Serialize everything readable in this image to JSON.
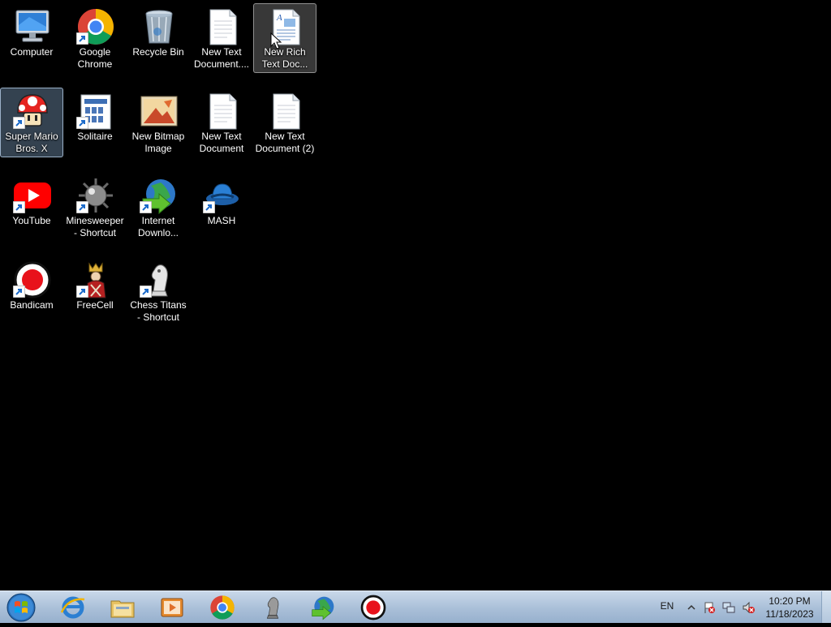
{
  "desktop": {
    "icons": [
      {
        "id": "computer",
        "label": "Computer",
        "icon": "computer-icon"
      },
      {
        "id": "chrome",
        "label": "Google Chrome",
        "icon": "chrome-icon"
      },
      {
        "id": "recycle",
        "label": "Recycle Bin",
        "icon": "recycle-bin-icon"
      },
      {
        "id": "txt1",
        "label": "New Text Document....",
        "icon": "text-document-icon"
      },
      {
        "id": "rtf",
        "label": "New Rich Text Doc...",
        "icon": "rich-text-document-icon"
      },
      {
        "id": "mario",
        "label": "Super Mario Bros. X",
        "icon": "mushroom-icon"
      },
      {
        "id": "solitaire",
        "label": "Solitaire",
        "icon": "solitaire-icon"
      },
      {
        "id": "bitmap",
        "label": "New Bitmap Image",
        "icon": "bitmap-image-icon"
      },
      {
        "id": "txt2",
        "label": "New Text Document",
        "icon": "text-document-icon"
      },
      {
        "id": "txt3",
        "label": "New Text Document (2)",
        "icon": "text-document-icon"
      },
      {
        "id": "youtube",
        "label": "YouTube",
        "icon": "youtube-icon"
      },
      {
        "id": "minesweeper",
        "label": "Minesweeper - Shortcut",
        "icon": "mine-icon"
      },
      {
        "id": "idm",
        "label": "Internet Downlo...",
        "icon": "internet-download-manager-icon"
      },
      {
        "id": "mash",
        "label": "MASH",
        "icon": "mash-icon"
      },
      {
        "id": "bandicam",
        "label": "Bandicam",
        "icon": "record-icon"
      },
      {
        "id": "freecell",
        "label": "FreeCell",
        "icon": "freecell-king-icon"
      },
      {
        "id": "chess",
        "label": "Chess Titans - Shortcut",
        "icon": "chess-knight-icon"
      }
    ]
  },
  "taskbar": {
    "pinned": [
      {
        "name": "internet-explorer",
        "icon": "internet-explorer-icon"
      },
      {
        "name": "file-explorer",
        "icon": "folder-icon"
      },
      {
        "name": "media-player",
        "icon": "media-player-icon"
      },
      {
        "name": "chrome",
        "icon": "chrome-icon"
      },
      {
        "name": "chess-titans",
        "icon": "chess-knight-icon"
      },
      {
        "name": "internet-download-manager",
        "icon": "internet-download-manager-icon"
      },
      {
        "name": "bandicam",
        "icon": "record-icon"
      }
    ],
    "language": "EN",
    "tray_icons": [
      "show-hidden-icons-icon",
      "action-center-flag-icon",
      "network-icon",
      "volume-muted-icon"
    ],
    "time": "10:20 PM",
    "date": "11/18/2023"
  }
}
